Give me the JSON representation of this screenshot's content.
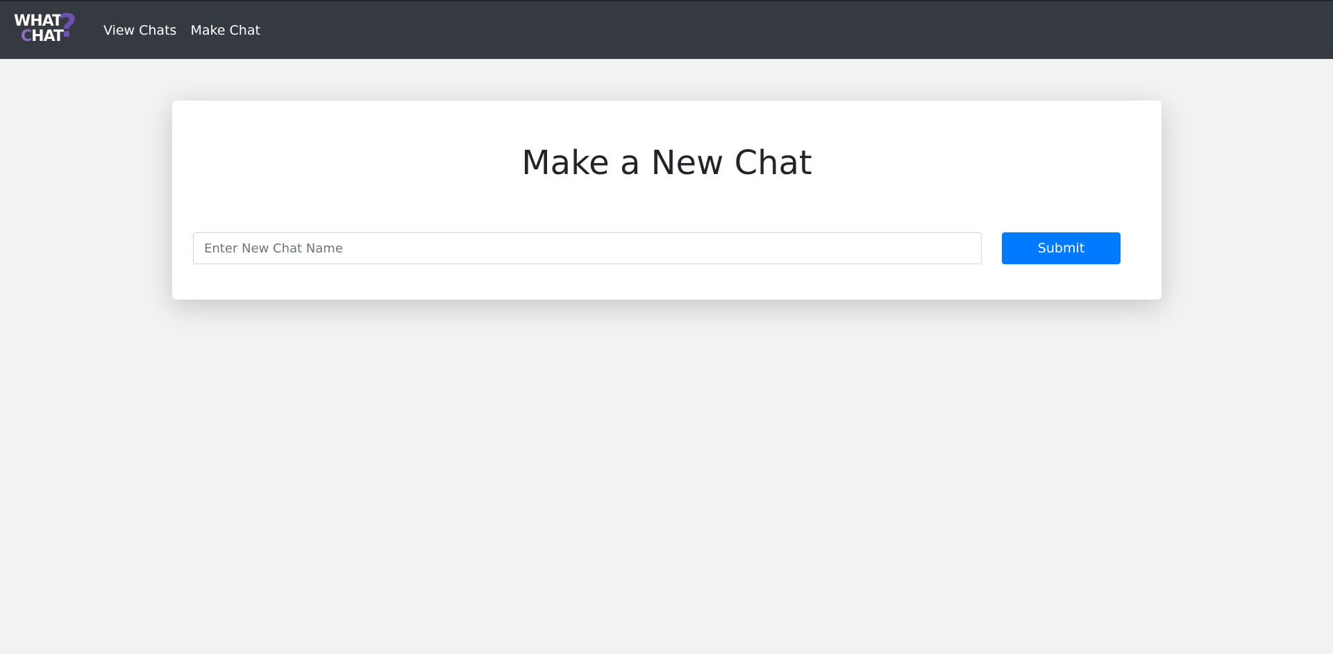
{
  "navbar": {
    "logo": {
      "line1": "WHAT",
      "line2_accent": "C",
      "line2_rest": "HAT",
      "question_mark": "?"
    },
    "links": [
      {
        "label": "View Chats"
      },
      {
        "label": "Make Chat"
      }
    ],
    "colors": {
      "background": "#343a40",
      "logo_accent": "#8f6fc2",
      "logo_question_mark": "#6f4fb0"
    }
  },
  "main": {
    "title": "Make a New Chat",
    "chat_name_input": {
      "value": "",
      "placeholder": "Enter New Chat Name"
    },
    "submit_label": "Submit",
    "colors": {
      "page_background": "#f2f2f2",
      "card_background": "#ffffff",
      "submit_button": "#007bff"
    }
  }
}
